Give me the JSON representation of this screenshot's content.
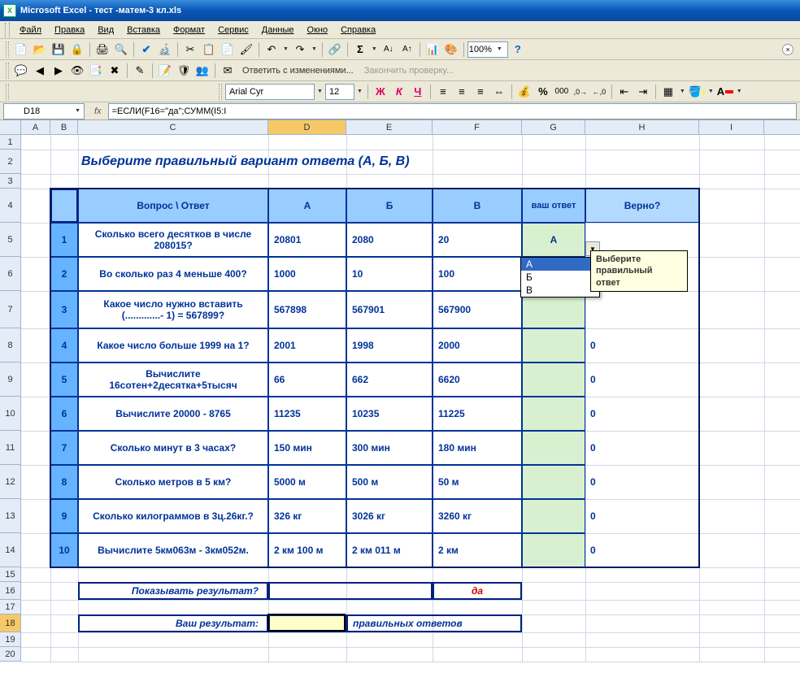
{
  "app": {
    "title": "Microsoft Excel - тест -матем-3 кл.xls"
  },
  "menu": {
    "file": "Файл",
    "edit": "Правка",
    "view": "Вид",
    "insert": "Вставка",
    "format": "Формат",
    "service": "Сервис",
    "data": "Данные",
    "window": "Окно",
    "help": "Справка"
  },
  "toolbar": {
    "font_name": "Arial Cyr",
    "font_size": "12",
    "zoom": "100%",
    "review_respond": "Ответить с изменениями...",
    "review_finish": "Закончить проверку..."
  },
  "formula": {
    "cell_ref": "D18",
    "fx": "fx",
    "value": "=ЕСЛИ(F16=\"да\";СУММ(I5:I"
  },
  "columns": [
    "A",
    "B",
    "C",
    "D",
    "E",
    "F",
    "G",
    "H",
    "I"
  ],
  "rows": [
    "1",
    "2",
    "3",
    "4",
    "5",
    "6",
    "7",
    "8",
    "9",
    "10",
    "11",
    "12",
    "13",
    "14",
    "15",
    "16",
    "17",
    "18",
    "19",
    "20"
  ],
  "sheet": {
    "title": "Выберите правильный вариант ответа (А, Б, В)",
    "header": {
      "question": "Вопрос   \\   Ответ",
      "a": "А",
      "b": "Б",
      "v": "В",
      "your": "ваш ответ",
      "correct": "Верно?"
    },
    "rowsdata": [
      {
        "n": "1",
        "q": "Сколько всего десятков в числе 208015?",
        "a": "20801",
        "b": "2080",
        "v": "20",
        "y": "А",
        "c": ""
      },
      {
        "n": "2",
        "q": "Во сколько раз 4 меньше 400?",
        "a": "1000",
        "b": "10",
        "v": "100",
        "y": "",
        "c": ""
      },
      {
        "n": "3",
        "q": "Какое число нужно вставить (.............- 1) = 567899?",
        "a": "567898",
        "b": "567901",
        "v": "567900",
        "y": "",
        "c": ""
      },
      {
        "n": "4",
        "q": "Какое число больше 1999 на 1?",
        "a": "2001",
        "b": "1998",
        "v": "2000",
        "y": "",
        "c": "0"
      },
      {
        "n": "5",
        "q": "Вычислите 16сотен+2десятка+5тысяч",
        "a": "66",
        "b": "662",
        "v": "6620",
        "y": "",
        "c": "0"
      },
      {
        "n": "6",
        "q": "Вычислите   20000 - 8765",
        "a": "11235",
        "b": "10235",
        "v": "11225",
        "y": "",
        "c": "0"
      },
      {
        "n": "7",
        "q": "Сколько минут в 3 часах?",
        "a": "150 мин",
        "b": " 300 мин",
        "v": "180 мин",
        "y": "",
        "c": "0"
      },
      {
        "n": "8",
        "q": "Сколько метров в 5 км?",
        "a": "5000 м",
        "b": "500 м",
        "v": " 50 м",
        "y": "",
        "c": "0"
      },
      {
        "n": "9",
        "q": "Сколько килограммов в 3ц.26кг.?",
        "a": " 326 кг",
        "b": "3026 кг",
        "v": "3260 кг",
        "y": "",
        "c": "0"
      },
      {
        "n": "10",
        "q": "Вычислите 5км063м - 3км052м.",
        "a": "2 км 100 м",
        "b": "2 км 011 м",
        "v": "2 км",
        "y": "",
        "c": "0"
      }
    ],
    "show_result_label": "Показывать результат?",
    "show_result_value": "да",
    "your_result_label": "Ваш результат:",
    "your_result_suffix": "правильных ответов"
  },
  "dropdown": {
    "options": [
      "А",
      "Б",
      "В"
    ],
    "tooltip": "Выберите правильный ответ"
  }
}
